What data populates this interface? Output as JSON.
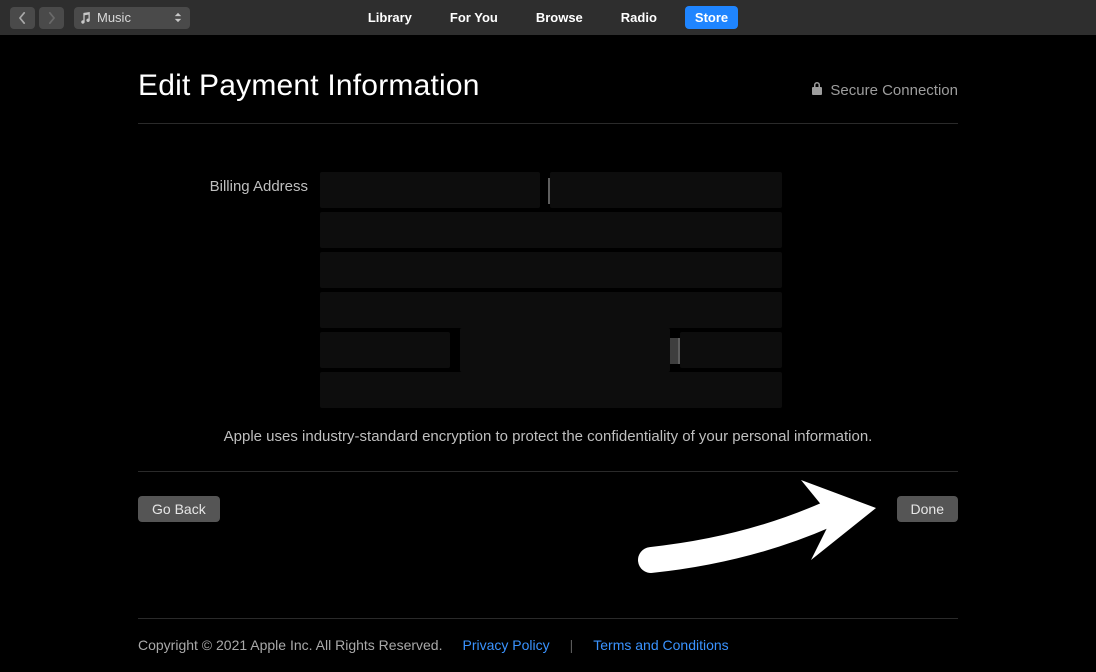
{
  "toolbar": {
    "media_label": "Music",
    "tabs": [
      "Library",
      "For You",
      "Browse",
      "Radio",
      "Store"
    ],
    "active_tab_index": 4
  },
  "page": {
    "title": "Edit Payment Information",
    "secure_label": "Secure Connection",
    "billing_label": "Billing Address",
    "info_text": "Apple uses industry-standard encryption to protect the confidentiality of your personal information.",
    "back_button": "Go Back",
    "done_button": "Done"
  },
  "footer": {
    "copyright": "Copyright © 2021 Apple Inc. All Rights Reserved.",
    "privacy": "Privacy Policy",
    "terms": "Terms and Conditions"
  }
}
